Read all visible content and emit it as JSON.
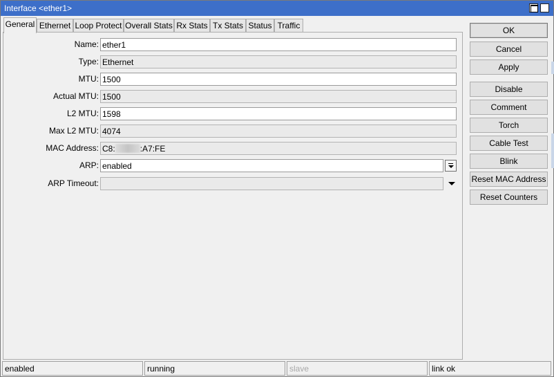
{
  "window": {
    "title": "Interface <ether1>",
    "maximize_icon": "maximize-icon",
    "close_glyph": "✕"
  },
  "tabs": [
    "General",
    "Ethernet",
    "Loop Protect",
    "Overall Stats",
    "Rx Stats",
    "Tx Stats",
    "Status",
    "Traffic"
  ],
  "active_tab": "General",
  "fields": {
    "name": {
      "label": "Name:",
      "value": "ether1"
    },
    "type": {
      "label": "Type:",
      "value": "Ethernet"
    },
    "mtu": {
      "label": "MTU:",
      "value": "1500"
    },
    "actual_mtu": {
      "label": "Actual MTU:",
      "value": "1500"
    },
    "l2_mtu": {
      "label": "L2 MTU:",
      "value": "1598"
    },
    "max_l2_mtu": {
      "label": "Max L2 MTU:",
      "value": "4074"
    },
    "mac_address": {
      "label": "MAC Address:",
      "value_start": "C8:",
      "value_end": ":A7:FE"
    },
    "arp": {
      "label": "ARP:",
      "value": "enabled"
    },
    "arp_timeout": {
      "label": "ARP Timeout:",
      "value": ""
    }
  },
  "buttons": {
    "ok": "OK",
    "cancel": "Cancel",
    "apply": "Apply",
    "disable": "Disable",
    "comment": "Comment",
    "torch": "Torch",
    "cable_test": "Cable Test",
    "blink": "Blink",
    "reset_mac": "Reset MAC Address",
    "reset_counters": "Reset Counters"
  },
  "status_bar": [
    "enabled",
    "running",
    "slave",
    "link ok"
  ],
  "colors": {
    "titlebar": "#3d6fc9",
    "panel": "#f0f0f0",
    "readonly_field": "#eaeaea"
  }
}
